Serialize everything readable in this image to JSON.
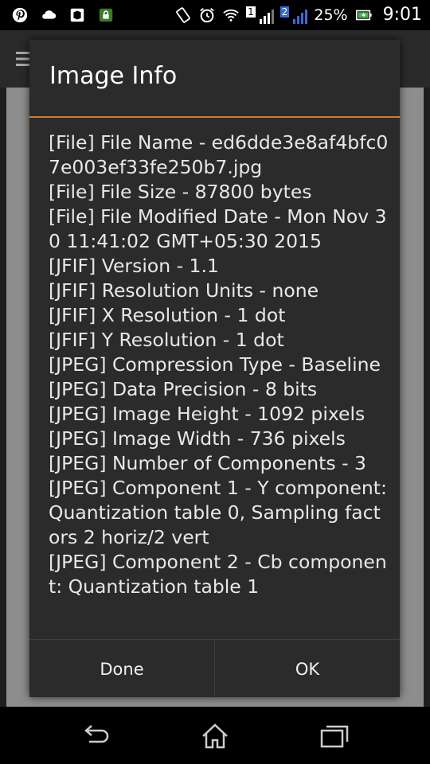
{
  "status_bar": {
    "left_icons": [
      "pinterest-icon",
      "cloud-icon",
      "news-icon",
      "lock-icon"
    ],
    "right_icons": [
      "vibrate-icon",
      "alarm-icon",
      "wifi-icon",
      "sim1-signal-icon",
      "sim2-signal-icon",
      "battery-charging-icon"
    ],
    "sim1_label": "1",
    "sim2_label": "2",
    "battery": "25%",
    "time": "9:01"
  },
  "dialog": {
    "title": "Image Info",
    "lines": [
      "[File] File Name - ed6dde3e8af4bfc07e003ef33fe250b7.jpg",
      "[File] File Size - 87800 bytes",
      "[File] File Modified Date - Mon Nov 30 11:41:02 GMT+05:30 2015",
      "[JFIF] Version - 1.1",
      "[JFIF] Resolution Units - none",
      "[JFIF] X Resolution - 1 dot",
      "[JFIF] Y Resolution - 1 dot",
      "[JPEG] Compression Type - Baseline",
      "[JPEG] Data Precision - 8 bits",
      "[JPEG] Image Height - 1092 pixels",
      "[JPEG] Image Width - 736 pixels",
      "[JPEG] Number of Components - 3",
      "[JPEG] Component 1 - Y component: Quantization table 0, Sampling factors 2 horiz/2 vert",
      "[JPEG] Component 2 - Cb component: Quantization table 1"
    ],
    "buttons": {
      "done": "Done",
      "ok": "OK"
    }
  },
  "colors": {
    "accent": "#ce7d2a",
    "dialog_bg": "#2b2b2b"
  },
  "nav_bar": [
    "back-icon",
    "home-icon",
    "recents-icon"
  ]
}
